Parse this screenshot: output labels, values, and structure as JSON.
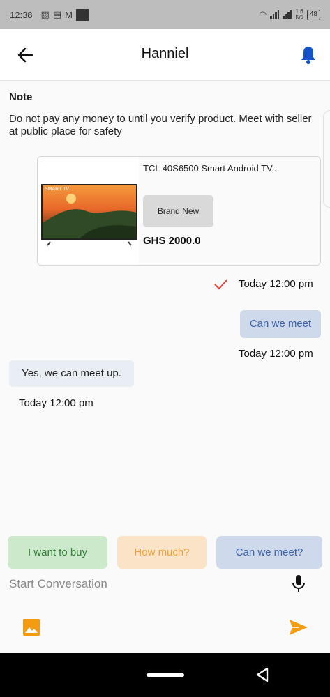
{
  "status_bar": {
    "time": "12:38",
    "net_speed_value": "1.6",
    "net_speed_unit": "K/s",
    "battery": "48"
  },
  "header": {
    "title": "Hanniel",
    "back_icon": "arrow-left-icon",
    "bell_icon": "bell-icon",
    "accent_color": "#1453c8"
  },
  "note": {
    "label": "Note",
    "text": "Do not pay any money to until you verify product. Meet with seller at public place for safety"
  },
  "product": {
    "title": "TCL 40S6500 Smart Android TV...",
    "condition": "Brand New",
    "price": "GHS 2000.0",
    "image_label": "SMART TV"
  },
  "messages": [
    {
      "direction": "out",
      "text": "",
      "time": "Today 12:00 pm",
      "status": "sent"
    },
    {
      "direction": "out",
      "text": "Can we meet",
      "time": "Today 12:00 pm"
    },
    {
      "direction": "in",
      "text": "Yes, we can meet up.",
      "time": "Today 12:00 pm"
    }
  ],
  "quick_replies": [
    {
      "label": "I want to buy",
      "bg": "#cde9cc",
      "color": "#2e7d32"
    },
    {
      "label": "How much?",
      "bg": "#fbe3c8",
      "color": "#f0a039"
    },
    {
      "label": "Can we meet?",
      "bg": "#cfd9ec",
      "color": "#3a63a8"
    }
  ],
  "composer": {
    "placeholder": "Start Conversation",
    "mic_icon": "mic-icon",
    "image_icon": "image-icon",
    "send_icon": "send-icon",
    "accent_color": "#f39c12"
  }
}
